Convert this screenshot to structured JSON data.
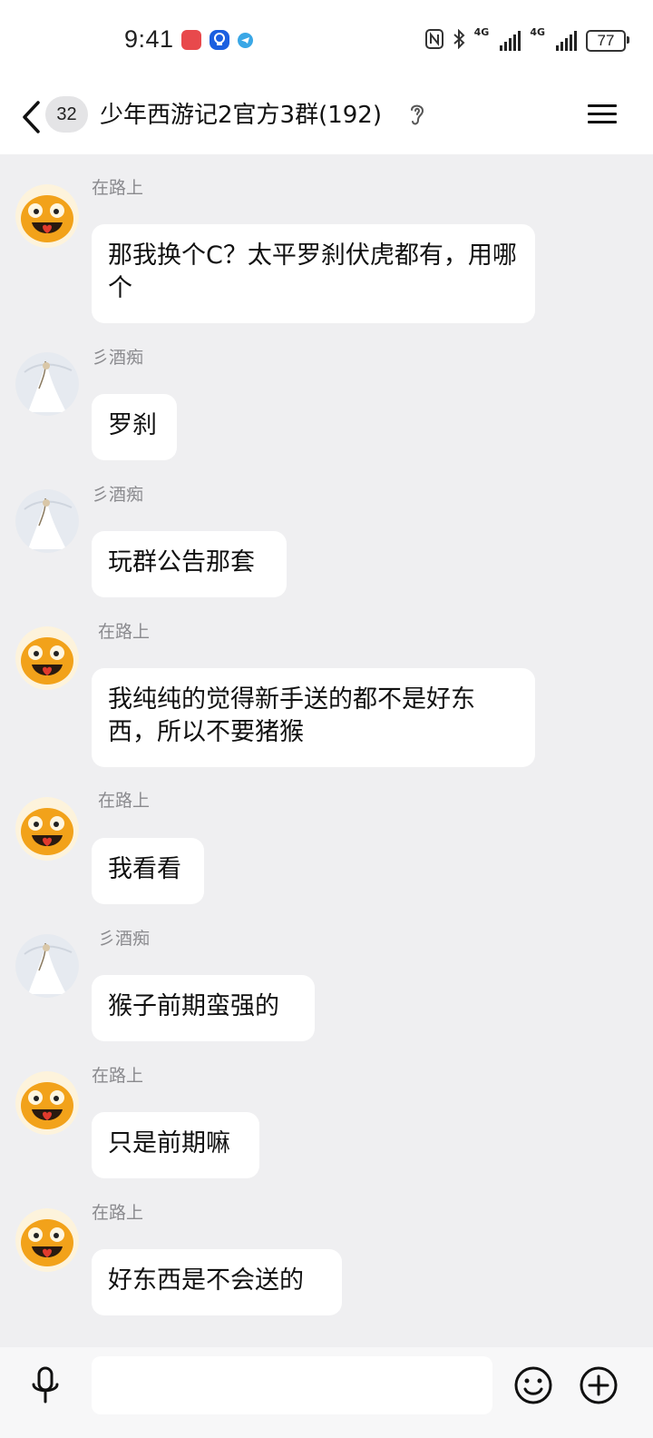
{
  "status_bar": {
    "time": "9:41",
    "network_left": "4G",
    "network_right": "4G",
    "battery": "77",
    "icons": [
      "huawei-app-icon",
      "bulb-app-icon",
      "telegram-icon",
      "nfc-icon",
      "bluetooth-icon",
      "signal-icon",
      "battery-icon"
    ]
  },
  "header": {
    "unread_count": "32",
    "title": "少年西游记2官方3群(192)",
    "icons": [
      "back-arrow-icon",
      "ear-icon",
      "menu-icon"
    ]
  },
  "messages": [
    {
      "sender": "在路上",
      "text": "那我换个C？太平罗刹伏虎都有，用哪个",
      "avatar": "orange-creature-avatar"
    },
    {
      "sender": "彡酒痴",
      "text": "罗刹",
      "avatar": "white-dress-figure-avatar"
    },
    {
      "sender": "彡酒痴",
      "text": "玩群公告那套",
      "avatar": "white-dress-figure-avatar"
    },
    {
      "sender": "在路上",
      "text": "我纯纯的觉得新手送的都不是好东西，所以不要猪猴",
      "avatar": "orange-creature-avatar"
    },
    {
      "sender": "在路上",
      "text": "我看看",
      "avatar": "orange-creature-avatar"
    },
    {
      "sender": "彡酒痴",
      "text": "猴子前期蛮强的",
      "avatar": "white-dress-figure-avatar"
    },
    {
      "sender": "在路上",
      "text": "只是前期嘛",
      "avatar": "orange-creature-avatar"
    },
    {
      "sender": "在路上",
      "text": "好东西是不会送的",
      "avatar": "orange-creature-avatar"
    }
  ],
  "input_bar": {
    "placeholder": "",
    "icons": [
      "microphone-icon",
      "emoji-icon",
      "plus-icon"
    ]
  },
  "colors": {
    "chat_background": "#efeff1",
    "bubble": "#ffffff",
    "sender_name": "#8a8a8e",
    "header": "#ffffff"
  }
}
